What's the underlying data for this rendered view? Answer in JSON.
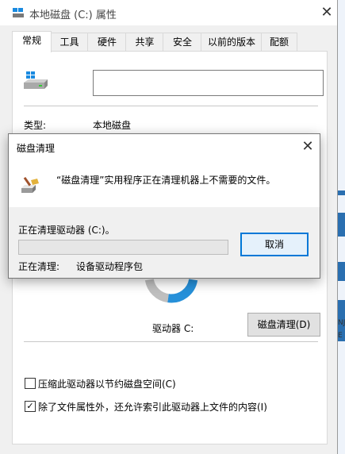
{
  "window": {
    "title": "本地磁盘 (C:) 属性",
    "close_glyph": "✕"
  },
  "tabs": [
    {
      "label": "常规",
      "active": true
    },
    {
      "label": "工具"
    },
    {
      "label": "硬件"
    },
    {
      "label": "共享"
    },
    {
      "label": "安全"
    },
    {
      "label": "以前的版本"
    },
    {
      "label": "配额"
    }
  ],
  "general": {
    "drive_name_value": "",
    "type_label": "类型:",
    "type_value": "本地磁盘",
    "drive_label": "驱动器 C:",
    "cleanup_button": "磁盘清理(D)",
    "compress_checkbox": {
      "label": "压缩此驱动器以节约磁盘空间(C)",
      "checked": false
    },
    "index_checkbox": {
      "label": "除了文件属性外，还允许索引此驱动器上文件的内容(I)",
      "checked": true
    },
    "donut_used_fraction": 0.55,
    "colors": {
      "used": "#2690d9",
      "free": "#bfbfbf"
    }
  },
  "dialog": {
    "title": "磁盘清理",
    "close_glyph": "✕",
    "message": "“磁盘清理”实用程序正在清理机器上不需要的文件。",
    "status_line": "正在清理驱动器 (C:)。",
    "cleaning_label": "正在清理:",
    "cleaning_item": "设备驱动程序包",
    "cancel_button": "取消",
    "progress_fraction": 0
  },
  "background_edge_text": [
    "NJ",
    "E"
  ]
}
